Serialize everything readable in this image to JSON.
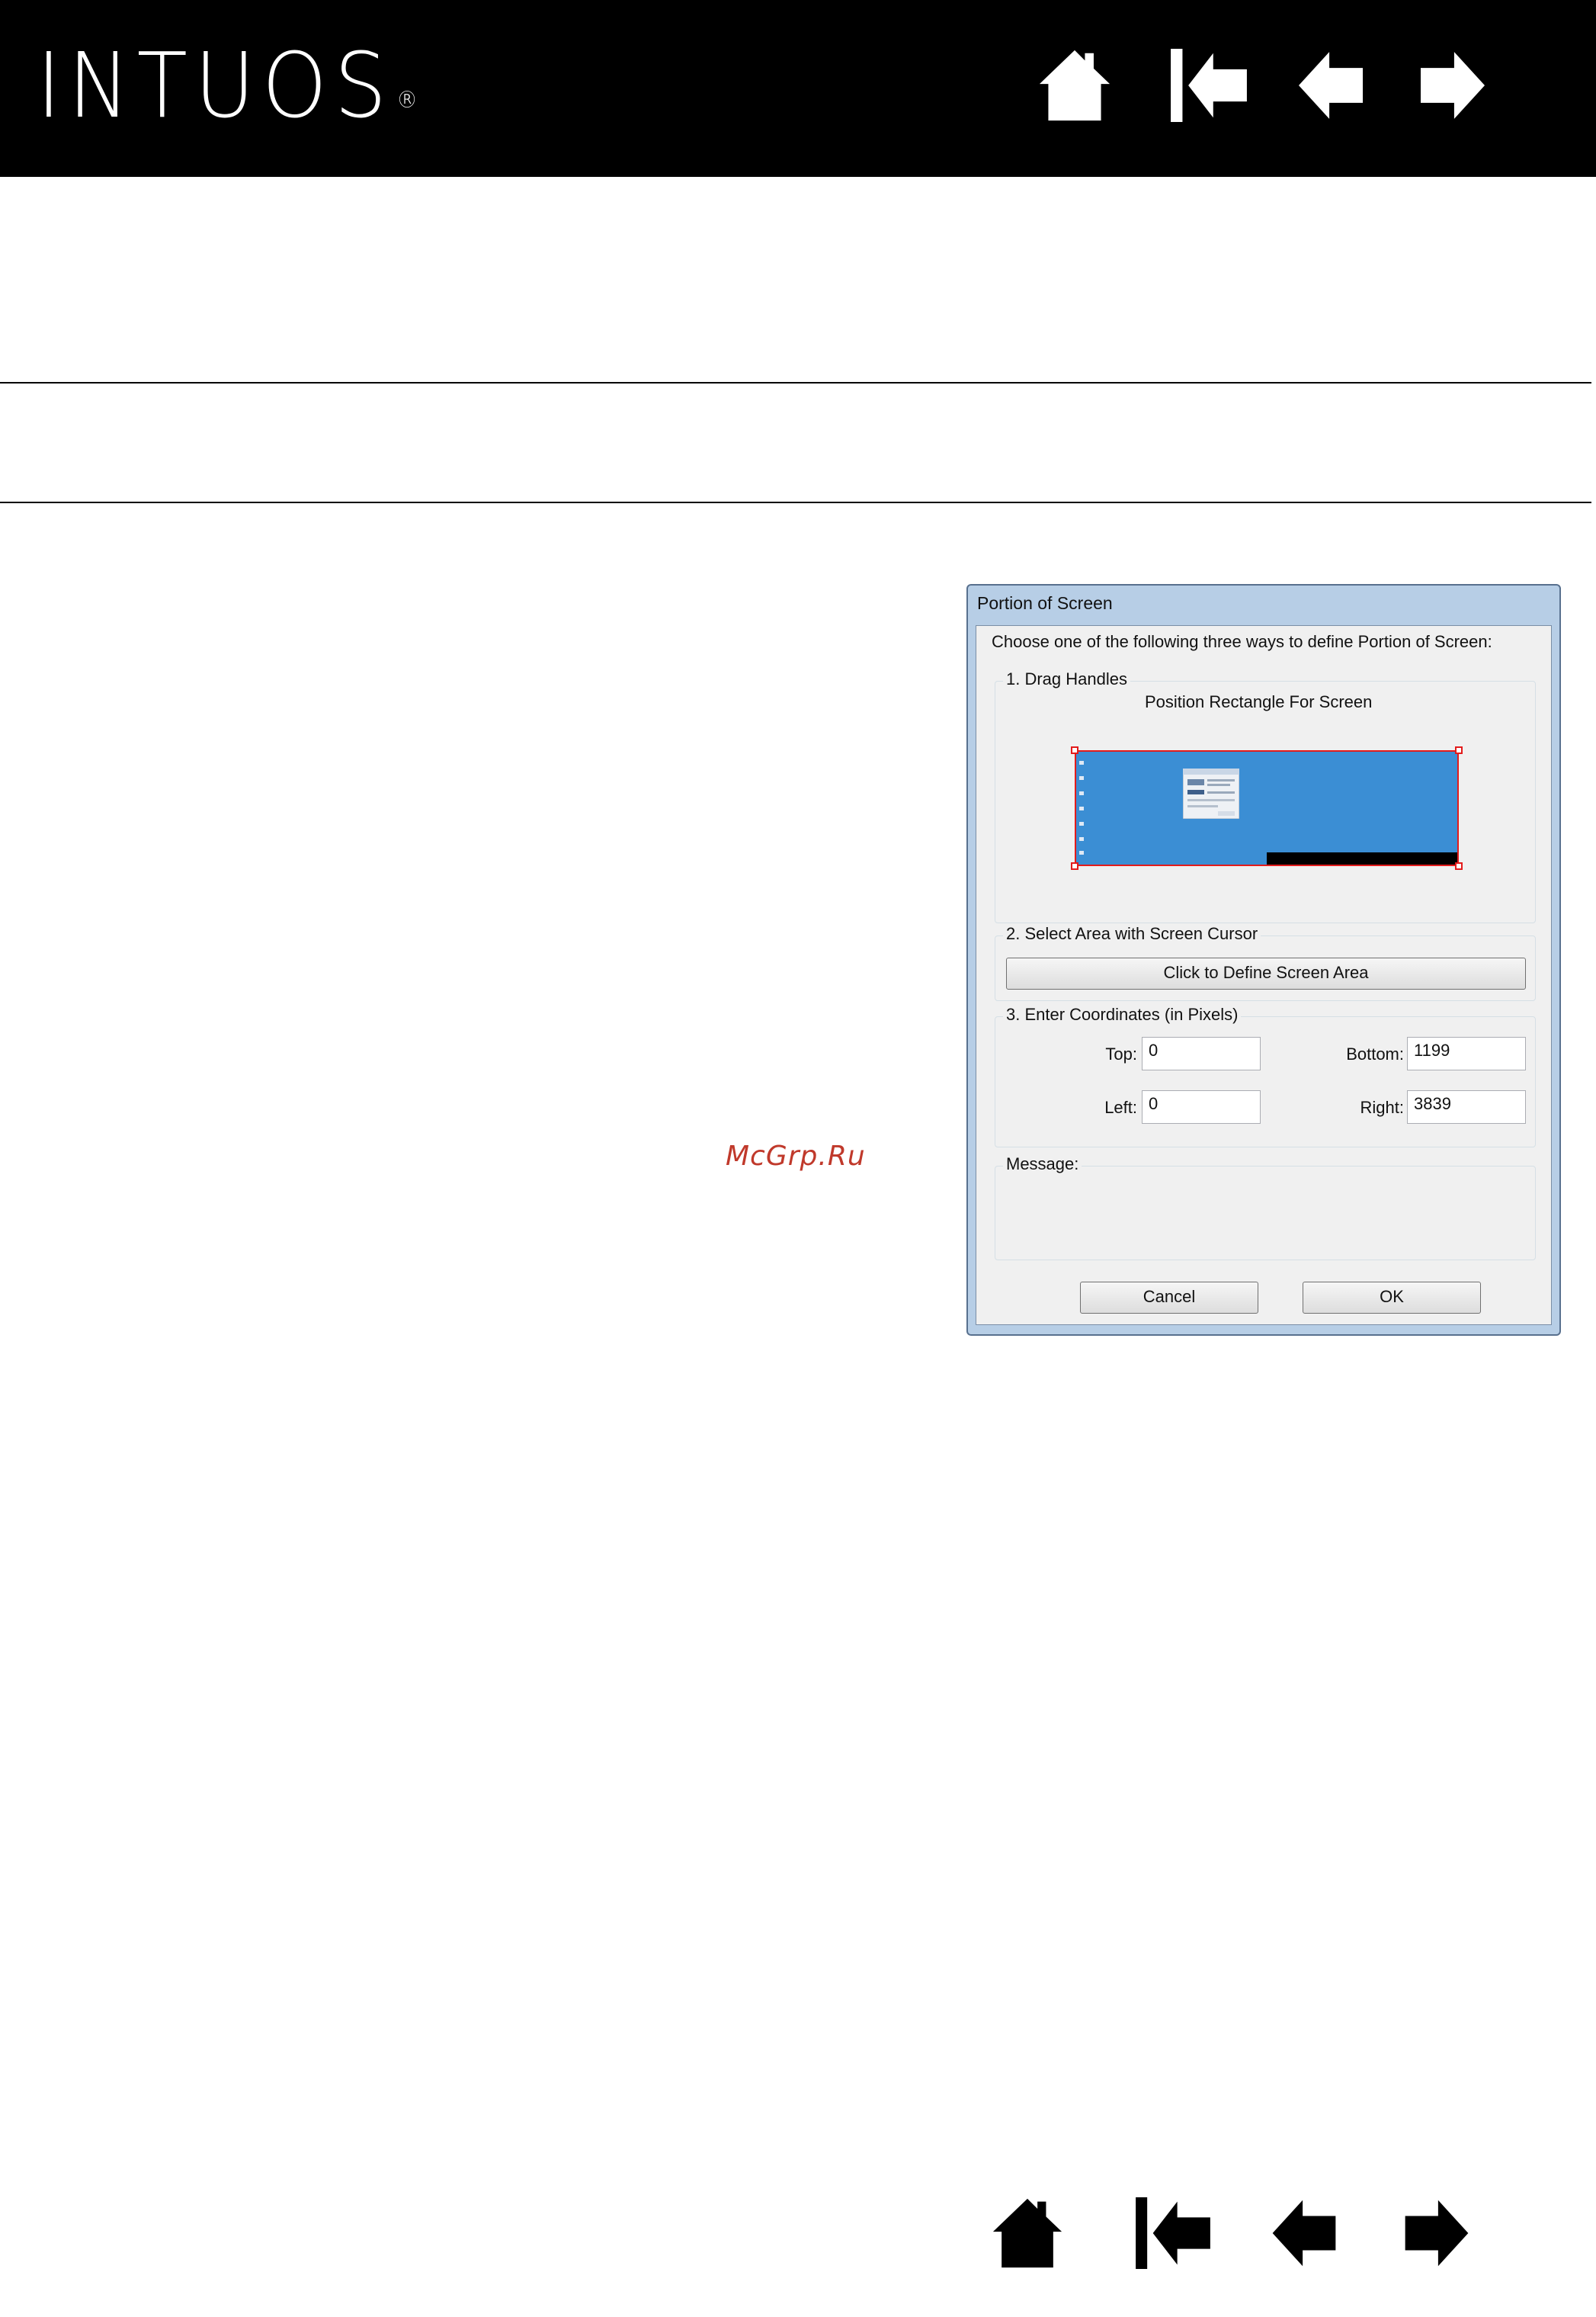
{
  "header": {
    "logo_text": "INTUOS",
    "logo_mark": "®",
    "nav_icons": [
      "home-icon",
      "first-page-icon",
      "previous-page-icon",
      "next-page-icon"
    ]
  },
  "watermark": "McGrp.Ru",
  "dialog": {
    "title": "Portion of Screen",
    "instruction": "Choose one of the following three ways to define Portion of Screen:",
    "drag_group": {
      "label": "1. Drag Handles",
      "caption": "Position Rectangle For Screen"
    },
    "select_group": {
      "label": "2. Select Area with Screen Cursor",
      "button": "Click to Define Screen Area"
    },
    "coords_group": {
      "label": "3. Enter Coordinates (in Pixels)",
      "top_label": "Top:",
      "top_value": "0",
      "bottom_label": "Bottom:",
      "bottom_value": "1199",
      "left_label": "Left:",
      "left_value": "0",
      "right_label": "Right:",
      "right_value": "3839"
    },
    "message_group": {
      "label": "Message:",
      "text": ""
    },
    "cancel_button": "Cancel",
    "ok_button": "OK"
  },
  "footer": {
    "nav_icons": [
      "home-icon",
      "first-page-icon",
      "previous-page-icon",
      "next-page-icon"
    ]
  },
  "colors": {
    "header_bg": "#000000",
    "preview_blue": "#3b8ed4",
    "selection_red": "#e31b1b",
    "watermark": "#c0392b"
  }
}
